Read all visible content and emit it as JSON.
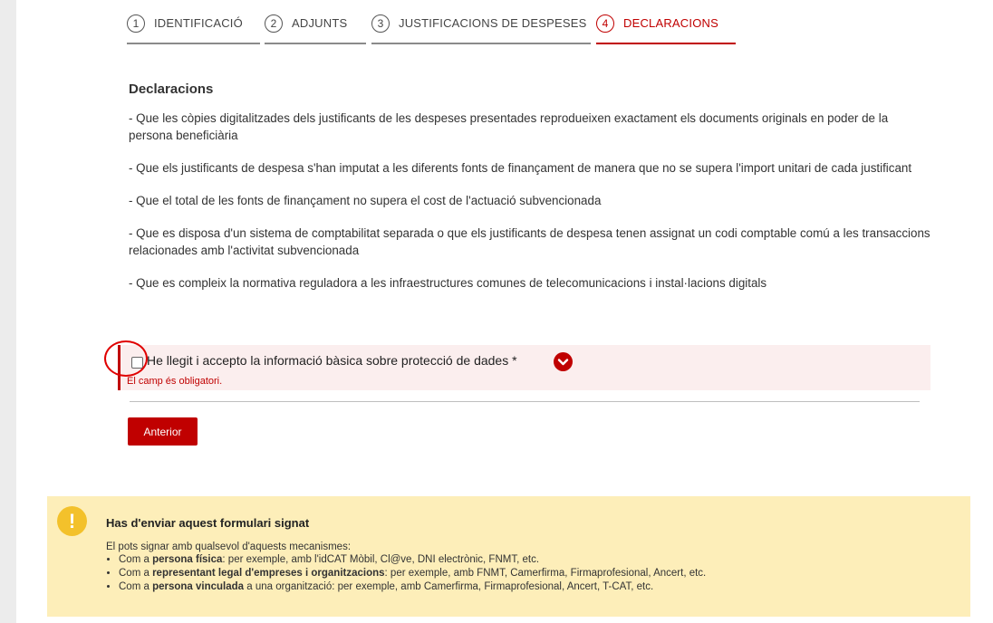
{
  "steps": [
    {
      "num": "1",
      "label": "IDENTIFICACIÓ"
    },
    {
      "num": "2",
      "label": "ADJUNTS"
    },
    {
      "num": "3",
      "label": "JUSTIFICACIONS DE DESPESES"
    },
    {
      "num": "4",
      "label": "DECLARACIONS"
    }
  ],
  "active_step": "4",
  "colors": {
    "accent": "#c00000",
    "notice_bg": "#fdeeb9",
    "warning_icon": "#f3c12b",
    "error_bg": "#fbeeee"
  },
  "declarations": {
    "title": "Declaracions",
    "items": [
      "- Que les còpies digitalitzades dels justificants de les despeses presentades reprodueixen exactament els documents originals en poder de la persona beneficiària",
      "- Que els justificants de despesa s'han imputat a les diferents fonts de finançament de manera que no se supera l'import unitari de cada justificant",
      "- Que el total de les fonts de finançament no supera el cost de l'actuació subvencionada",
      "- Que es disposa d'un sistema de comptabilitat separada o que els justificants de despesa tenen assignat un codi comptable comú a les transaccions relacionades amb l'activitat subvencionada",
      "- Que es compleix la normativa reguladora a les infraestructures comunes de telecomunicacions i instal·lacions digitals"
    ]
  },
  "consent": {
    "label": "He llegit i accepto la informació bàsica sobre protecció de dades *",
    "error": "El camp és obligatori.",
    "checked": false
  },
  "buttons": {
    "previous": "Anterior"
  },
  "notice": {
    "icon": "exclamation-icon",
    "title": "Has d'enviar aquest formulari signat",
    "intro": "El pots signar amb qualsevol d'aquests mecanismes:",
    "items": [
      {
        "pre": "Com a ",
        "bold": "persona física",
        "post": ": per exemple, amb l'idCAT Mòbil, Cl@ve, DNI electrònic, FNMT, etc."
      },
      {
        "pre": "Com a ",
        "bold": "representant legal d'empreses i organitzacions",
        "post": ": per exemple, amb FNMT, Camerfirma, Firmaprofesional, Ancert, etc."
      },
      {
        "pre": "Com a ",
        "bold": "persona vinculada",
        "post": " a una organització: per exemple, amb Camerfirma, Firmaprofesional, Ancert, T-CAT, etc."
      }
    ]
  }
}
